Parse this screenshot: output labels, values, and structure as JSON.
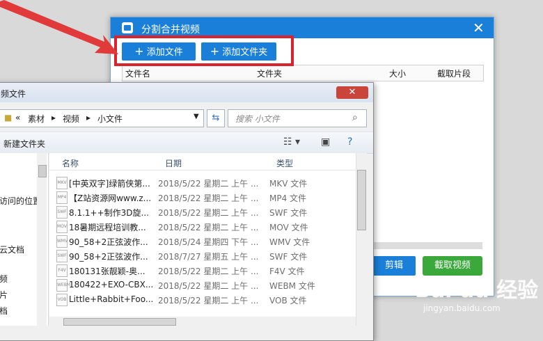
{
  "dialog": {
    "title": "分割合并视频",
    "add_file": "添加文件",
    "add_folder": "添加文件夹",
    "columns": [
      "文件名",
      "文件夹",
      "大小",
      "截取片段"
    ],
    "edit_btn": "剪辑",
    "capture_btn": "截取视频",
    "close": "✕"
  },
  "file_dialog": {
    "title": "频文件",
    "path": [
      "素材",
      "视频",
      "小文件"
    ],
    "search_placeholder": "搜索 小文件",
    "new_folder": "新建文件夹",
    "columns": [
      "名称",
      "日期",
      "类型"
    ],
    "nav_items": [
      "访问的位置",
      "云文档",
      "频",
      "片",
      "档"
    ],
    "files": [
      {
        "name": "[中英双字]绿箭侠第...",
        "date": "2018/5/22 星期二 上午 ...",
        "type": "MKV 文件",
        "icon": "MKV"
      },
      {
        "name": "【Z站资源网www.z...",
        "date": "2018/5/22 星期二 上午 ...",
        "type": "MP4 文件",
        "icon": "MP4"
      },
      {
        "name": "8.1.1++制作3D旋...",
        "date": "2018/5/22 星期二 上午 ...",
        "type": "SWF 文件",
        "icon": "SWF"
      },
      {
        "name": "18暑期远程培训教...",
        "date": "2018/5/22 星期二 上午 ...",
        "type": "MOV 文件",
        "icon": "MOV"
      },
      {
        "name": "90_58+2正弦波作...",
        "date": "2018/5/24 星期四 下午 ...",
        "type": "WMV 文件",
        "icon": "WMV"
      },
      {
        "name": "90_58+2正弦波作...",
        "date": "2018/7/27 星期五 上午 ...",
        "type": "SWF 文件",
        "icon": "SWF"
      },
      {
        "name": "180131张靓颖-奥...",
        "date": "2018/5/22 星期二 上午 ...",
        "type": "F4V 文件",
        "icon": "F4V"
      },
      {
        "name": "180422+EXO-CBX...",
        "date": "2018/5/22 星期二 上午 ...",
        "type": "WEBM 文件",
        "icon": "WEBM"
      },
      {
        "name": "Little+Rabbit+Foo...",
        "date": "2018/5/22 星期二 上午 ...",
        "type": "VOB 文件",
        "icon": "VOB"
      }
    ]
  },
  "watermark": {
    "brand": "Bai du 经验",
    "url": "jingyan.baidu.com"
  },
  "colors": {
    "accent": "#1a7fd8",
    "green": "#3aa83a",
    "highlight": "#d9232d"
  }
}
